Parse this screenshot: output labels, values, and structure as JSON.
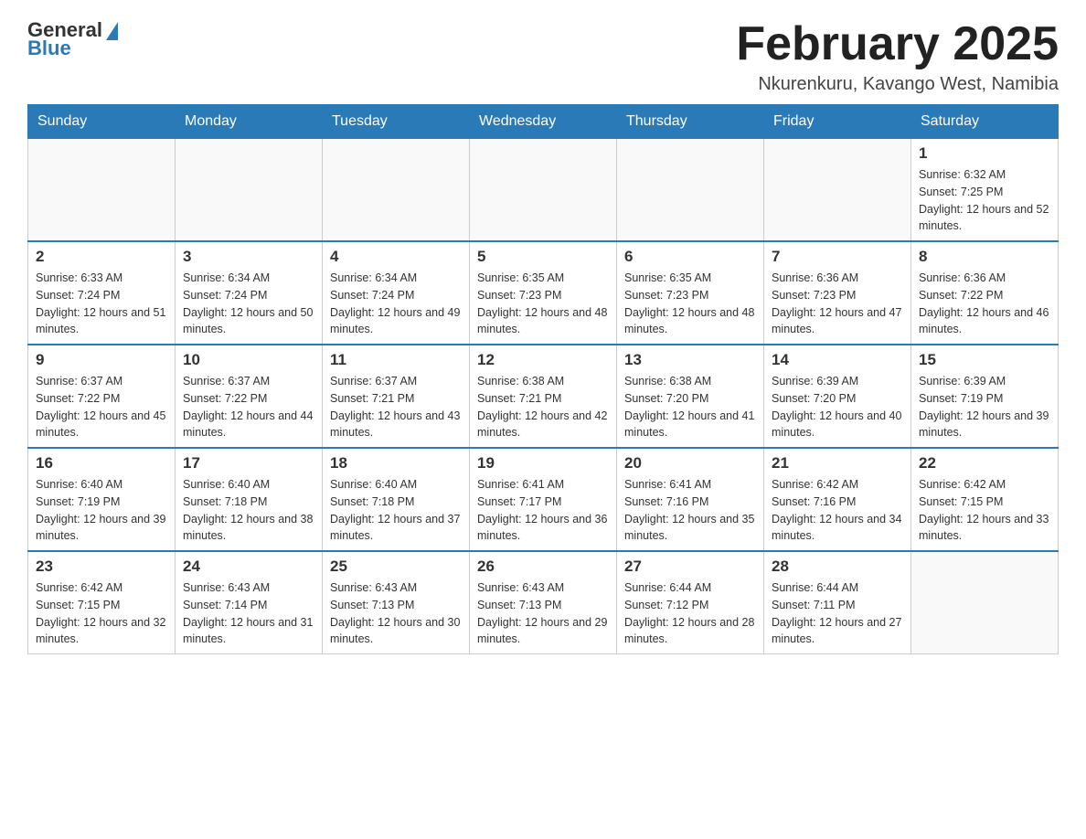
{
  "header": {
    "logo": {
      "general_text": "General",
      "blue_text": "Blue"
    },
    "title": "February 2025",
    "location": "Nkurenkuru, Kavango West, Namibia"
  },
  "calendar": {
    "days_of_week": [
      "Sunday",
      "Monday",
      "Tuesday",
      "Wednesday",
      "Thursday",
      "Friday",
      "Saturday"
    ],
    "weeks": [
      [
        {
          "day": "",
          "info": ""
        },
        {
          "day": "",
          "info": ""
        },
        {
          "day": "",
          "info": ""
        },
        {
          "day": "",
          "info": ""
        },
        {
          "day": "",
          "info": ""
        },
        {
          "day": "",
          "info": ""
        },
        {
          "day": "1",
          "info": "Sunrise: 6:32 AM\nSunset: 7:25 PM\nDaylight: 12 hours and 52 minutes."
        }
      ],
      [
        {
          "day": "2",
          "info": "Sunrise: 6:33 AM\nSunset: 7:24 PM\nDaylight: 12 hours and 51 minutes."
        },
        {
          "day": "3",
          "info": "Sunrise: 6:34 AM\nSunset: 7:24 PM\nDaylight: 12 hours and 50 minutes."
        },
        {
          "day": "4",
          "info": "Sunrise: 6:34 AM\nSunset: 7:24 PM\nDaylight: 12 hours and 49 minutes."
        },
        {
          "day": "5",
          "info": "Sunrise: 6:35 AM\nSunset: 7:23 PM\nDaylight: 12 hours and 48 minutes."
        },
        {
          "day": "6",
          "info": "Sunrise: 6:35 AM\nSunset: 7:23 PM\nDaylight: 12 hours and 48 minutes."
        },
        {
          "day": "7",
          "info": "Sunrise: 6:36 AM\nSunset: 7:23 PM\nDaylight: 12 hours and 47 minutes."
        },
        {
          "day": "8",
          "info": "Sunrise: 6:36 AM\nSunset: 7:22 PM\nDaylight: 12 hours and 46 minutes."
        }
      ],
      [
        {
          "day": "9",
          "info": "Sunrise: 6:37 AM\nSunset: 7:22 PM\nDaylight: 12 hours and 45 minutes."
        },
        {
          "day": "10",
          "info": "Sunrise: 6:37 AM\nSunset: 7:22 PM\nDaylight: 12 hours and 44 minutes."
        },
        {
          "day": "11",
          "info": "Sunrise: 6:37 AM\nSunset: 7:21 PM\nDaylight: 12 hours and 43 minutes."
        },
        {
          "day": "12",
          "info": "Sunrise: 6:38 AM\nSunset: 7:21 PM\nDaylight: 12 hours and 42 minutes."
        },
        {
          "day": "13",
          "info": "Sunrise: 6:38 AM\nSunset: 7:20 PM\nDaylight: 12 hours and 41 minutes."
        },
        {
          "day": "14",
          "info": "Sunrise: 6:39 AM\nSunset: 7:20 PM\nDaylight: 12 hours and 40 minutes."
        },
        {
          "day": "15",
          "info": "Sunrise: 6:39 AM\nSunset: 7:19 PM\nDaylight: 12 hours and 39 minutes."
        }
      ],
      [
        {
          "day": "16",
          "info": "Sunrise: 6:40 AM\nSunset: 7:19 PM\nDaylight: 12 hours and 39 minutes."
        },
        {
          "day": "17",
          "info": "Sunrise: 6:40 AM\nSunset: 7:18 PM\nDaylight: 12 hours and 38 minutes."
        },
        {
          "day": "18",
          "info": "Sunrise: 6:40 AM\nSunset: 7:18 PM\nDaylight: 12 hours and 37 minutes."
        },
        {
          "day": "19",
          "info": "Sunrise: 6:41 AM\nSunset: 7:17 PM\nDaylight: 12 hours and 36 minutes."
        },
        {
          "day": "20",
          "info": "Sunrise: 6:41 AM\nSunset: 7:16 PM\nDaylight: 12 hours and 35 minutes."
        },
        {
          "day": "21",
          "info": "Sunrise: 6:42 AM\nSunset: 7:16 PM\nDaylight: 12 hours and 34 minutes."
        },
        {
          "day": "22",
          "info": "Sunrise: 6:42 AM\nSunset: 7:15 PM\nDaylight: 12 hours and 33 minutes."
        }
      ],
      [
        {
          "day": "23",
          "info": "Sunrise: 6:42 AM\nSunset: 7:15 PM\nDaylight: 12 hours and 32 minutes."
        },
        {
          "day": "24",
          "info": "Sunrise: 6:43 AM\nSunset: 7:14 PM\nDaylight: 12 hours and 31 minutes."
        },
        {
          "day": "25",
          "info": "Sunrise: 6:43 AM\nSunset: 7:13 PM\nDaylight: 12 hours and 30 minutes."
        },
        {
          "day": "26",
          "info": "Sunrise: 6:43 AM\nSunset: 7:13 PM\nDaylight: 12 hours and 29 minutes."
        },
        {
          "day": "27",
          "info": "Sunrise: 6:44 AM\nSunset: 7:12 PM\nDaylight: 12 hours and 28 minutes."
        },
        {
          "day": "28",
          "info": "Sunrise: 6:44 AM\nSunset: 7:11 PM\nDaylight: 12 hours and 27 minutes."
        },
        {
          "day": "",
          "info": ""
        }
      ]
    ]
  }
}
